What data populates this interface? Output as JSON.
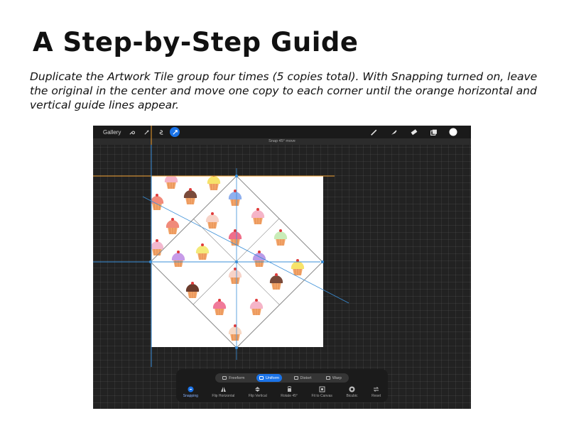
{
  "heading": "A Step-by-Step Guide",
  "instructions": "Duplicate the Artwork Tile group four times (5 copies total). With Snapping turned on, leave the original in the center and move one copy to each corner until the orange horizontal and vertical guide lines appear.",
  "app": {
    "gallery_label": "Gallery",
    "status_text": "Snap 45° move",
    "top_left_icons": [
      "wrench-icon",
      "magic-wand-icon",
      "selection-icon",
      "transform-arrow-icon"
    ],
    "top_right_icons": [
      "brush-icon",
      "smudge-icon",
      "eraser-icon",
      "layers-icon",
      "color-swatch-icon"
    ],
    "colors": {
      "accent": "#1a73e8",
      "guide_orange": "#f0a030",
      "guide_blue": "#3a8fd8",
      "canvas_bg": "#222222"
    },
    "modes": [
      {
        "label": "Freeform",
        "active": false
      },
      {
        "label": "Uniform",
        "active": true
      },
      {
        "label": "Distort",
        "active": false
      },
      {
        "label": "Warp",
        "active": false
      }
    ],
    "actions": [
      {
        "label": "Snapping",
        "icon": "snapping-icon",
        "active": true
      },
      {
        "label": "Flip Horizontal",
        "icon": "flip-horizontal-icon",
        "active": false
      },
      {
        "label": "Flip Vertical",
        "icon": "flip-vertical-icon",
        "active": false
      },
      {
        "label": "Rotate 45°",
        "icon": "rotate-icon",
        "active": false
      },
      {
        "label": "Fit to Canvas",
        "icon": "fit-canvas-icon",
        "active": false
      },
      {
        "label": "Bicubic",
        "icon": "bicubic-icon",
        "active": false
      },
      {
        "label": "Reset",
        "icon": "reset-icon",
        "active": false
      }
    ]
  }
}
